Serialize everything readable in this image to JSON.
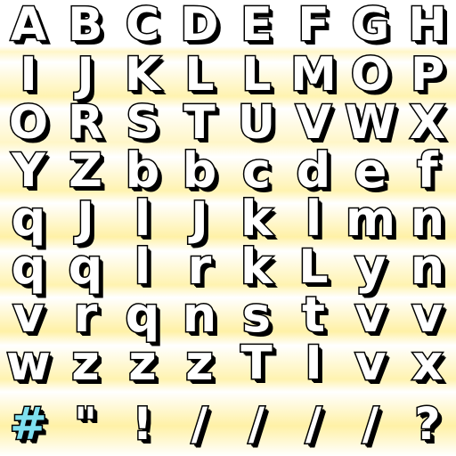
{
  "glyph_rows": [
    [
      "A",
      "B",
      "C",
      "D",
      "E",
      "F",
      "G",
      "H"
    ],
    [
      "I",
      "J",
      "K",
      "L",
      "L",
      "M",
      "O",
      "P"
    ],
    [
      "O",
      "R",
      "S",
      "T",
      "U",
      "V",
      "W",
      "X"
    ],
    [
      "Y",
      "Z",
      "b",
      "b",
      "c",
      "d",
      "e",
      "f"
    ],
    [
      "q",
      "J",
      "l",
      "J",
      "k",
      "l",
      "m",
      "n"
    ],
    [
      "q",
      "q",
      "l",
      "r",
      "k",
      "L",
      "y",
      "n"
    ],
    [
      "v",
      "r",
      "q",
      "n",
      "s",
      "t",
      "v",
      "v"
    ],
    [
      "w",
      "z",
      "z",
      "z",
      "T",
      "I",
      "v",
      "x"
    ],
    [
      "#",
      "\"",
      "!",
      "/",
      "/",
      "/",
      "/",
      "?"
    ]
  ],
  "colors": {
    "glyph_fill": "#ffffff",
    "glyph_outline": "#000000",
    "stripe_yellow": "#fff1a6",
    "hash_fill": "#7fe0f0"
  }
}
